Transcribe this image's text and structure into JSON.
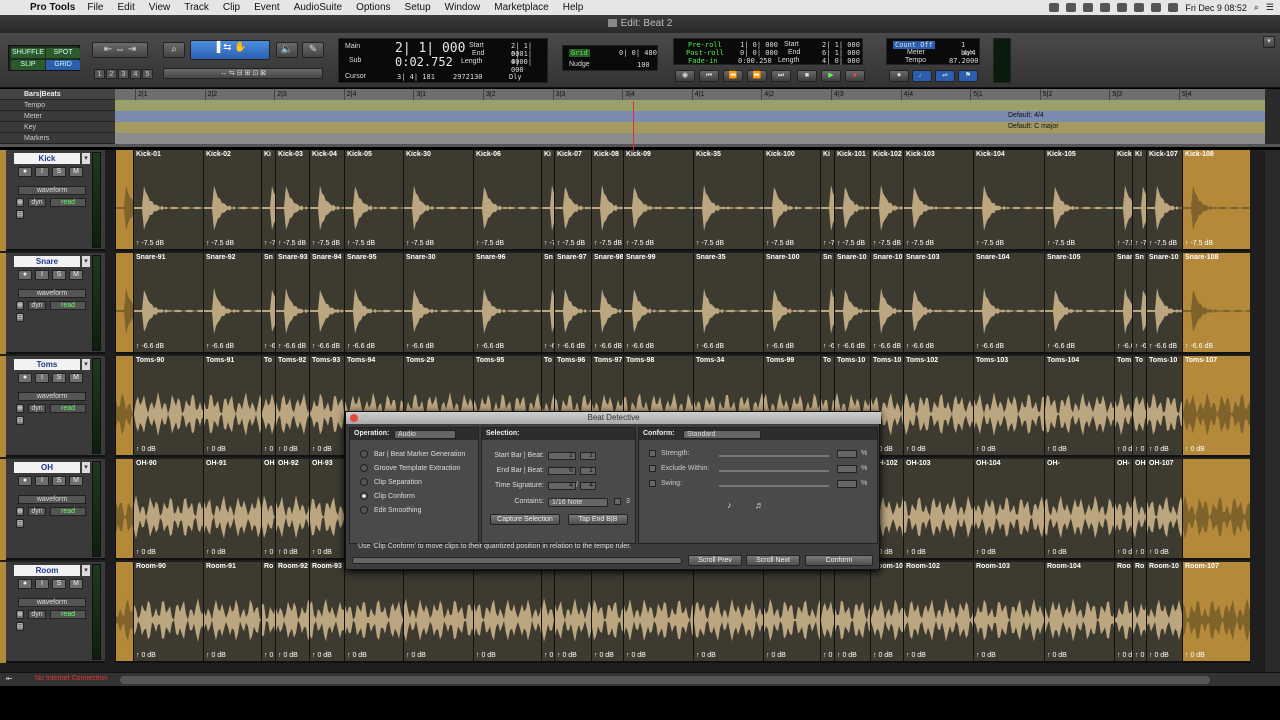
{
  "menubar": {
    "app": "Pro Tools",
    "items": [
      "File",
      "Edit",
      "View",
      "Track",
      "Clip",
      "Event",
      "AudioSuite",
      "Options",
      "Setup",
      "Window",
      "Marketplace",
      "Help"
    ],
    "clock": "Fri Dec 9  08:52"
  },
  "window": {
    "title": "Edit: Beat 2"
  },
  "modes": {
    "shuffle": "SHUFFLE",
    "spot": "SPOT",
    "slip": "SLIP",
    "grid": "GRID"
  },
  "zoom_presets": [
    "1",
    "2",
    "3",
    "4",
    "5"
  ],
  "main_counter": {
    "main_label": "Main",
    "main_value": "2| 1| 000",
    "sub_label": "Sub",
    "sub_value": "0:02.752",
    "start_label": "Start",
    "start_value": "2| 1| 000",
    "end_label": "End",
    "end_value": "6| 1| 000",
    "length_label": "Length",
    "length_value": "4| 0| 000",
    "cursor_label": "Cursor",
    "cursor_value": "3| 4| 181",
    "samples": "2972130",
    "dly": "Dly"
  },
  "grid": {
    "grid_label": "Grid",
    "grid_value": "0| 0| 480",
    "nudge_label": "Nudge",
    "nudge_value": "100"
  },
  "transport_counter": {
    "preroll_label": "Pre-roll",
    "preroll_value": "1| 0| 000",
    "postroll_label": "Post-roll",
    "postroll_value": "0| 0| 000",
    "fadein_label": "Fade-in",
    "fadein_value": "0:00.250",
    "start_label": "Start",
    "start_value": "2| 1| 000",
    "end_label": "End",
    "end_value": "6| 1| 000",
    "length_label": "Length",
    "length_value": "4| 0| 000"
  },
  "midi_counter": {
    "countoff": "Count Off",
    "countoff_value": "1 bar",
    "meter_label": "Meter",
    "meter_value": "4/4",
    "tempo_label": "Tempo",
    "tempo_value": "87.2000"
  },
  "rulers": {
    "bars_beats": "Bars|Beats",
    "tempo": "Tempo",
    "meter": "Meter",
    "key": "Key",
    "markers": "Markers",
    "meter_default": "Default: 4/4",
    "key_default": "Default: C major",
    "ticks": [
      "2|1",
      "2|2",
      "2|3",
      "2|4",
      "3|1",
      "3|2",
      "3|3",
      "3|4",
      "4|1",
      "4|2",
      "4|3",
      "4|4",
      "5|1",
      "5|2",
      "5|3",
      "5|4"
    ]
  },
  "tracks": [
    {
      "name": "Kick",
      "view": "waveform",
      "dyn": "dyn",
      "auto": "read",
      "clips": [
        "Kick-01",
        "Kick-02",
        "Ki",
        "Kick-03",
        "Kick-04",
        "Kick-05",
        "Kick-30",
        "Kick-06",
        "Ki",
        "Kick-07",
        "Kick-08",
        "Kick-09",
        "Kick-35",
        "Kick-100",
        "Ki",
        "Kick-101",
        "Kick-102",
        "Kick-103",
        "Kick-104",
        "Kick-105",
        "Kick",
        "Ki",
        "Kick-107",
        "Kick-108"
      ],
      "gain": "-7.5 dB"
    },
    {
      "name": "Snare",
      "view": "waveform",
      "dyn": "dyn",
      "auto": "read",
      "clips": [
        "Snare-91",
        "Snare-92",
        "Sn",
        "Snare-93",
        "Snare-94",
        "Snare-95",
        "Snare-30",
        "Snare-96",
        "Sn",
        "Snare-97",
        "Snare-98",
        "Snare-99",
        "Snare-35",
        "Snare-100",
        "Sn",
        "Snare-10",
        "Snare-10",
        "Snare-103",
        "Snare-104",
        "Snare-105",
        "Snar",
        "Sn",
        "Snare-10",
        "Snare-108"
      ],
      "gain": "-6.6 dB"
    },
    {
      "name": "Toms",
      "view": "waveform",
      "dyn": "dyn",
      "auto": "read",
      "clips": [
        "Toms-90",
        "Toms-91",
        "To",
        "Toms-92",
        "Toms-93",
        "Toms-94",
        "Toms-29",
        "Toms-95",
        "To",
        "Toms-96",
        "Toms-97",
        "Toms-98",
        "Toms-34",
        "Toms-99",
        "To",
        "Toms-10",
        "Toms-10",
        "Toms-102",
        "Toms-103",
        "Toms-104",
        "Tom",
        "To",
        "Toms-10",
        "Toms-107"
      ],
      "gain": "0 dB"
    },
    {
      "name": "OH",
      "view": "waveform",
      "dyn": "dyn",
      "auto": "read",
      "clips": [
        "OH-90",
        "OH-91",
        "OH",
        "OH-92",
        "OH-93",
        "",
        "",
        "",
        "",
        "",
        "",
        "",
        "",
        "",
        "",
        "-101",
        "OH-102",
        "OH-103",
        "OH-104",
        "OH-",
        "OH-",
        "OH-106",
        "OH-107",
        ""
      ],
      "gain": "0 dB"
    },
    {
      "name": "Room",
      "view": "waveform",
      "dyn": "dyn",
      "auto": "read",
      "clips": [
        "Room-90",
        "Room-91",
        "Ro",
        "Room-92",
        "Room-93",
        "Room-94",
        "Room-29",
        "Room-95",
        "Ro",
        "Room-96",
        "Room-97",
        "Room-98",
        "Room-34",
        "Room-99",
        "Ro",
        "Room-10",
        "Room-10",
        "Room-102",
        "Room-103",
        "Room-104",
        "Roo",
        "Ro",
        "Room-10",
        "Room-107"
      ],
      "gain": "0 dB"
    }
  ],
  "status": {
    "error": "No Internet Connection"
  },
  "beat_detective": {
    "title": "Beat Detective",
    "operation_label": "Operation:",
    "operation_value": "Audio",
    "options": [
      "Bar | Beat Marker Generation",
      "Groove Template Extraction",
      "Clip Separation",
      "Clip Conform",
      "Edit Smoothing"
    ],
    "selected_option": 3,
    "selection_label": "Selection:",
    "start_label": "Start Bar | Beat:",
    "start_bar": "2",
    "start_beat": "1",
    "end_label": "End Bar | Beat:",
    "end_bar": "6",
    "end_beat": "1",
    "timesig_label": "Time Signature:",
    "timesig_num": "4",
    "timesig_den": "4",
    "contains_label": "Contains:",
    "contains_value": "1/16 Note",
    "triplet": "3",
    "capture_button": "Capture Selection",
    "tap_button": "Tap End B|B",
    "conform_label": "Conform:",
    "conform_value": "Standard",
    "strength_label": "Strength:",
    "exclude_label": "Exclude Within:",
    "swing_label": "Swing:",
    "pct": "%",
    "help_text": "Use 'Clip Conform' to move clips to their quantized position in relation to the tempo ruler.",
    "scroll_prev": "Scroll Prev",
    "scroll_next": "Scroll Next",
    "conform_button": "Conform"
  },
  "colors": {
    "accent": "#2a5fb0",
    "clip_bg": "#3d3a30",
    "waveform": "#c9b38a",
    "tempo_ruler": "#9aa06a",
    "meter_ruler": "#7a8ab0"
  }
}
